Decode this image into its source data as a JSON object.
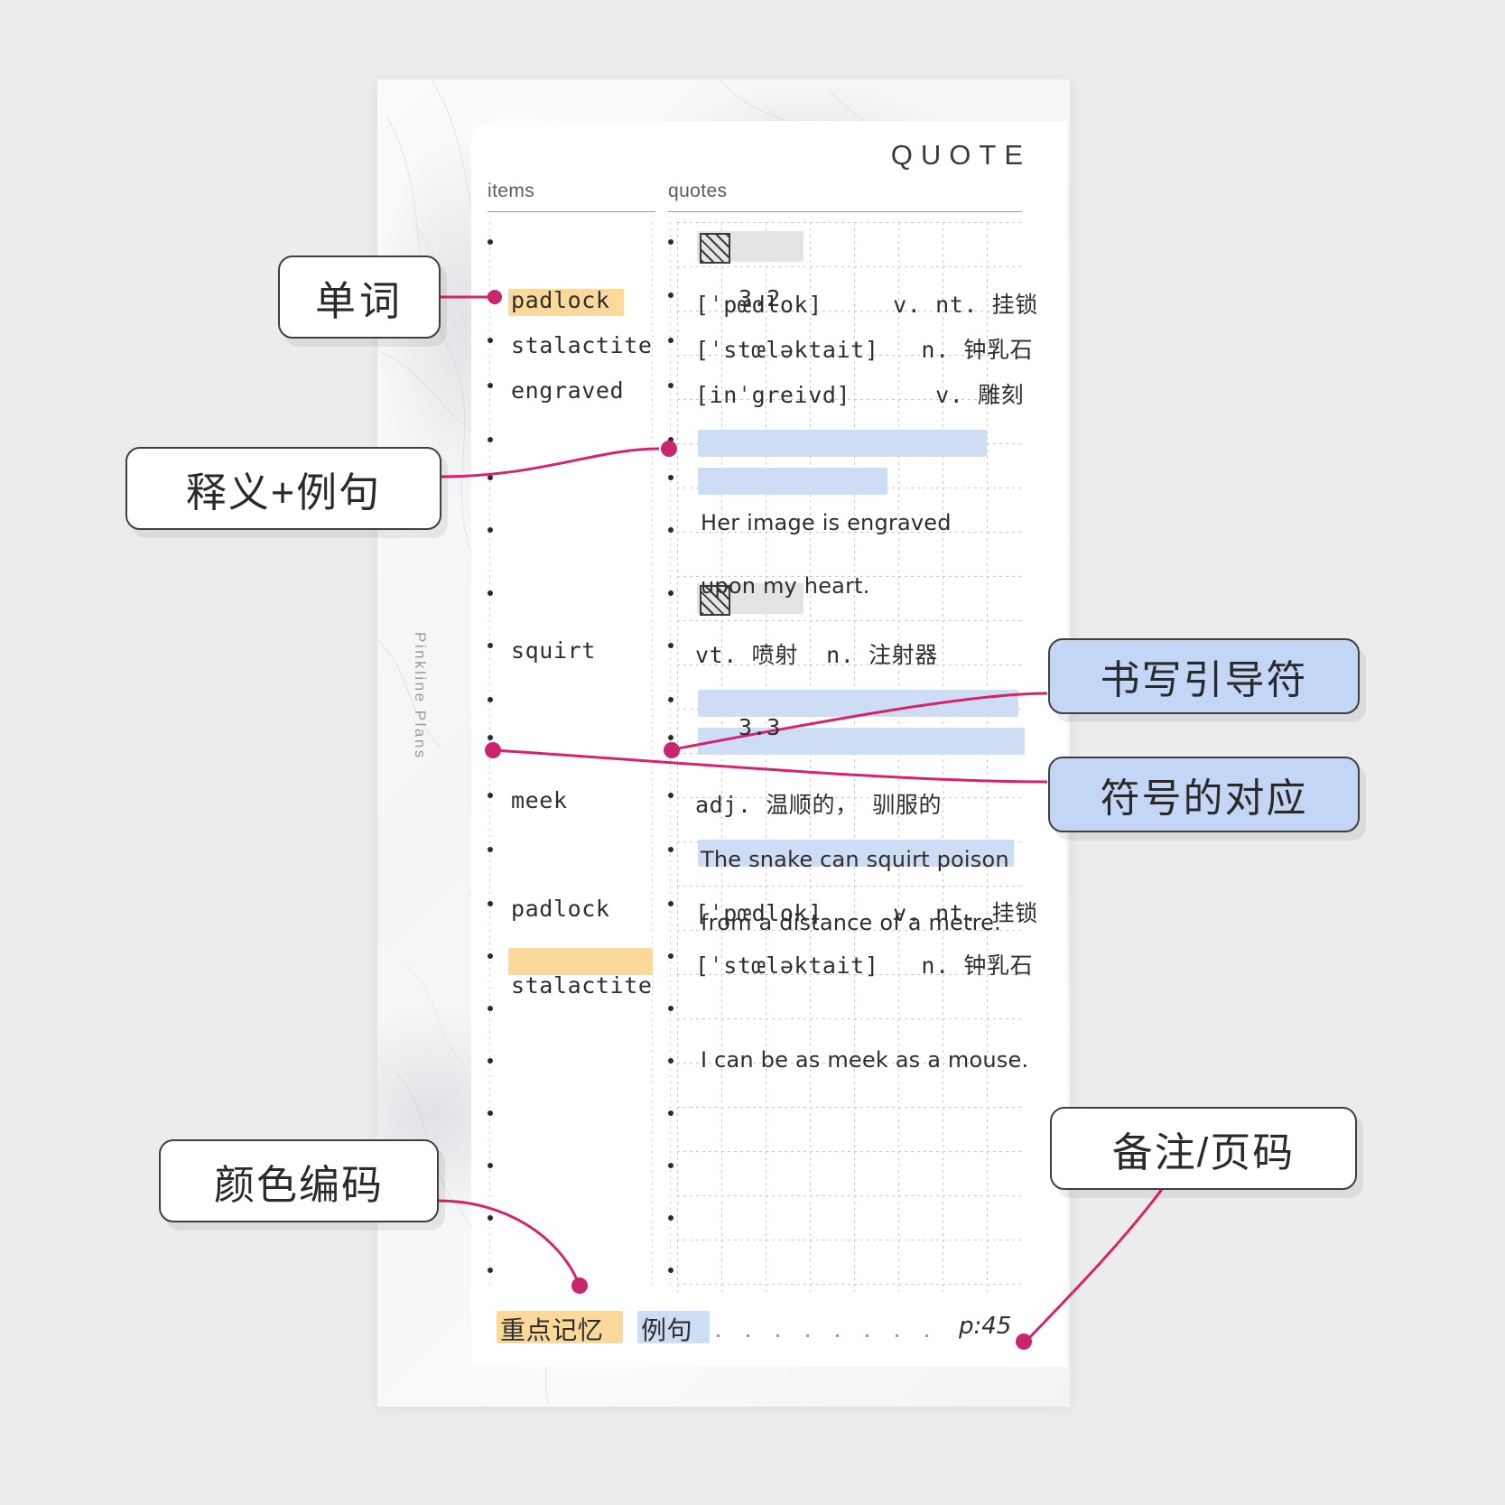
{
  "brand": "Pinkline Plans",
  "header": {
    "title": "QUOTE"
  },
  "columns": {
    "items_label": "items",
    "quotes_label": "quotes"
  },
  "items": [
    {
      "text": "padlock",
      "highlight": "orange"
    },
    {
      "text": "stalactite",
      "highlight": "none"
    },
    {
      "text": "engraved",
      "highlight": "none"
    },
    {
      "text": "squirt",
      "highlight": "none"
    },
    {
      "text": "meek",
      "highlight": "none"
    },
    {
      "text": "padlock",
      "highlight": "none"
    },
    {
      "text": "stalactite",
      "highlight": "orange"
    }
  ],
  "quotes": [
    {
      "text": "3.2",
      "type": "section",
      "highlight": "grey"
    },
    {
      "text": "[ˈpœdlok]     v. nt. 挂锁",
      "type": "definition",
      "highlight": "none"
    },
    {
      "text": "[ˈstœləktait]   n. 钟乳石",
      "type": "definition",
      "highlight": "none"
    },
    {
      "text": "[inˈgreivd]      v. 雕刻",
      "type": "definition",
      "highlight": "none"
    },
    {
      "text": "Her image is engraved",
      "type": "example",
      "highlight": "blue"
    },
    {
      "text": "upon my heart.",
      "type": "example",
      "highlight": "blue"
    },
    {
      "text": "3.3",
      "type": "section",
      "highlight": "grey"
    },
    {
      "text": "vt. 喷射  n. 注射器",
      "type": "definition",
      "highlight": "none"
    },
    {
      "text": "The snake can squirt poison",
      "type": "example",
      "highlight": "blue"
    },
    {
      "text": "from a distance of a metre.",
      "type": "example",
      "highlight": "blue"
    },
    {
      "text": "adj. 温顺的， 驯服的",
      "type": "definition",
      "highlight": "none"
    },
    {
      "text": "I can be as meek as a mouse.",
      "type": "example",
      "highlight": "blue"
    },
    {
      "text": "[ˈpœdlok]     v. nt. 挂锁",
      "type": "definition",
      "highlight": "none"
    },
    {
      "text": "[ˈstœləktait]   n. 钟乳石",
      "type": "definition",
      "highlight": "none"
    }
  ],
  "footer": {
    "legend_key": "重点记忆",
    "legend_example": "例句",
    "page_number": "p:45"
  },
  "annotations": [
    {
      "id": "a1",
      "label": "单词",
      "style": "white",
      "side": "left"
    },
    {
      "id": "a2",
      "label": "释义+例句",
      "style": "white",
      "side": "left"
    },
    {
      "id": "a3",
      "label": "书写引导符",
      "style": "blue",
      "side": "right"
    },
    {
      "id": "a4",
      "label": "符号的对应",
      "style": "blue",
      "side": "right"
    },
    {
      "id": "a5",
      "label": "颜色编码",
      "style": "white",
      "side": "left"
    },
    {
      "id": "a6",
      "label": "备注/页码",
      "style": "white",
      "side": "right"
    }
  ],
  "colors": {
    "accent_pink": "#d6236e",
    "highlight_orange": "#fbd99a",
    "highlight_blue": "#cdddf4",
    "callout_blue": "#c3d6f5",
    "background": "#ececec"
  }
}
